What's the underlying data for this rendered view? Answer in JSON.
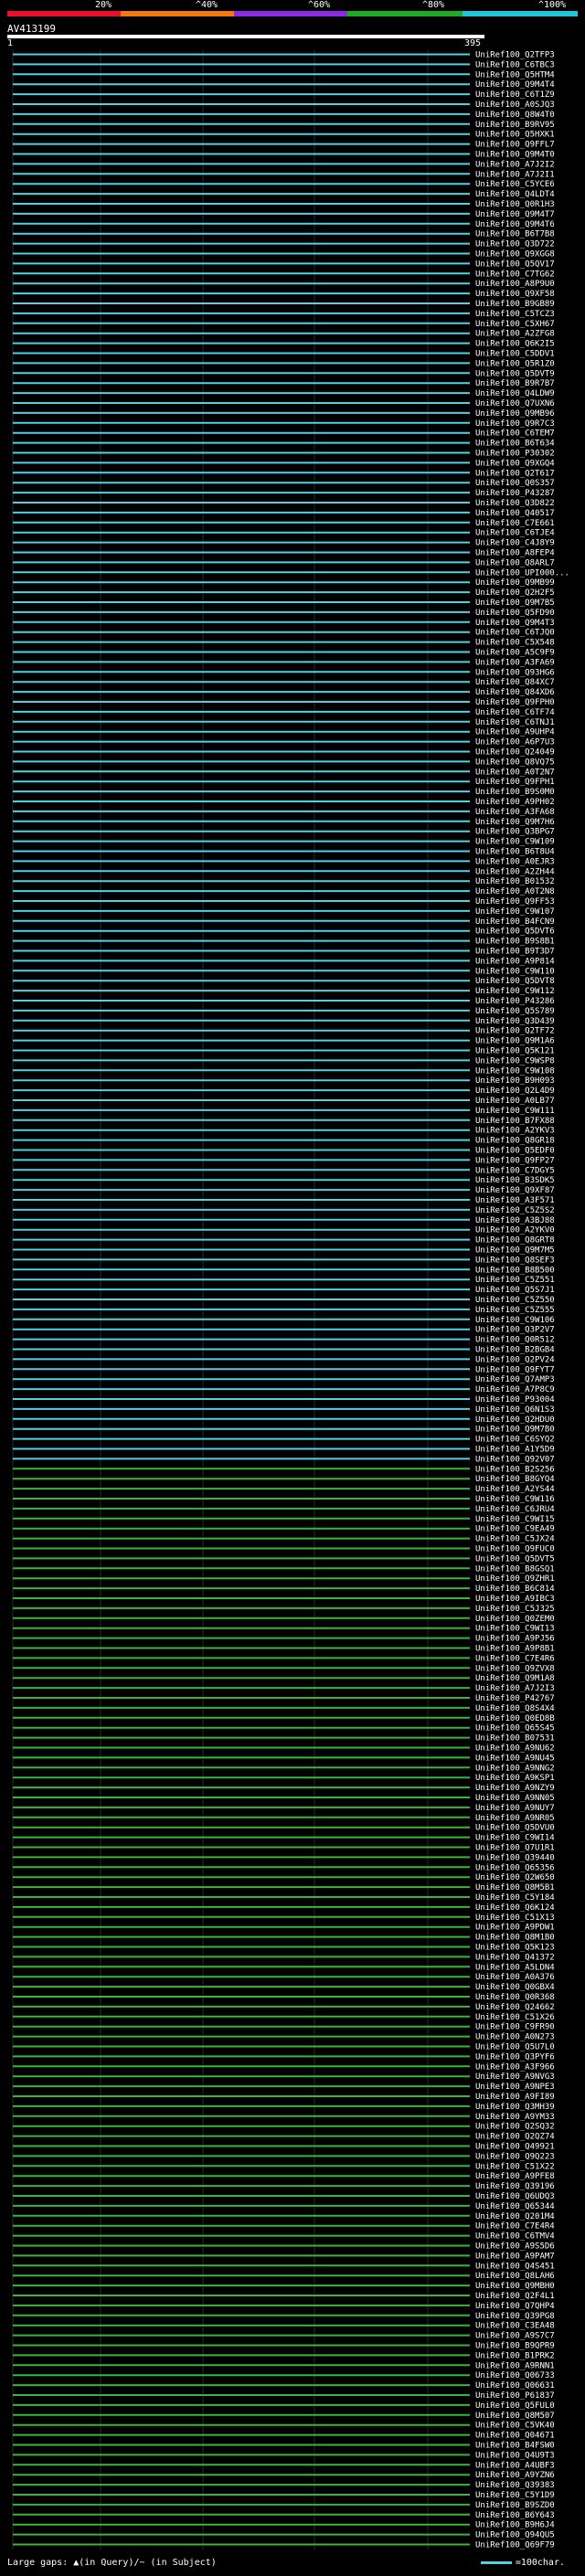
{
  "header": {
    "scale_labels": [
      "20%",
      "^40%",
      "^60%",
      "^80%",
      "^100%"
    ],
    "scale_colors": [
      "#e8102a",
      "#f07a10",
      "#8a2be2",
      "#22a822",
      "#22c4d8"
    ]
  },
  "query": {
    "title": "AV413199",
    "start": "1",
    "end": "395"
  },
  "footer": {
    "legend": "Large gaps: ▲(in Query)/~ (in Subject)",
    "scale_label": "=100char."
  },
  "colors": {
    "cyan": "#4fd1e8",
    "green": "#39b539",
    "grid": "#2a2a2a"
  },
  "hits": [
    "UniRef100_Q2TFP3",
    "UniRef100_C6TBC3",
    "UniRef100_Q5HTM4",
    "UniRef100_Q9M4T4",
    "UniRef100_C6T1Z9",
    "UniRef100_A0SJQ3",
    "UniRef100_Q8W4T0",
    "UniRef100_B9RV95",
    "UniRef100_Q5HXK1",
    "UniRef100_Q9FFL7",
    "UniRef100_Q9M4T0",
    "UniRef100_A7J2I2",
    "UniRef100_A7J2I1",
    "UniRef100_C5YCE6",
    "UniRef100_Q4LDT4",
    "UniRef100_Q0R1H3",
    "UniRef100_Q9M4T7",
    "UniRef100_Q9M4T6",
    "UniRef100_B6T7B8",
    "UniRef100_Q3D722",
    "UniRef100_Q9XGG8",
    "UniRef100_Q5QV17",
    "UniRef100_C7TG62",
    "UniRef100_A8P9U0",
    "UniRef100_Q9XF58",
    "UniRef100_B9GB89",
    "UniRef100_C5TCZ3",
    "UniRef100_C5XH67",
    "UniRef100_A2ZFG8",
    "UniRef100_Q6K2I5",
    "UniRef100_C5DDV1",
    "UniRef100_Q5R1Z0",
    "UniRef100_Q5DVT9",
    "UniRef100_B9R7B7",
    "UniRef100_Q4LDW9",
    "UniRef100_Q7UXN6",
    "UniRef100_Q9MB96",
    "UniRef100_Q9R7C3",
    "UniRef100_C6TEM7",
    "UniRef100_B6T634",
    "UniRef100_P30302",
    "UniRef100_Q9XGQ4",
    "UniRef100_Q2T617",
    "UniRef100_Q0S357",
    "UniRef100_P43287",
    "UniRef100_Q3D822",
    "UniRef100_Q40517",
    "UniRef100_C7E661",
    "UniRef100_C6TJE4",
    "UniRef100_C4J8Y9",
    "UniRef100_A8FEP4",
    "UniRef100_Q8ARL7",
    "UniRef100_UPI000...",
    "UniRef100_Q9MB99",
    "UniRef100_Q2H2F5",
    "UniRef100_Q9M7B5",
    "UniRef100_Q5FD90",
    "UniRef100_Q9M4T3",
    "UniRef100_C6TJQ0",
    "UniRef100_C5X548",
    "UniRef100_A5C9F9",
    "UniRef100_A3FA69",
    "UniRef100_Q93HG6",
    "UniRef100_Q84XC7",
    "UniRef100_Q84XD6",
    "UniRef100_Q9FPH0",
    "UniRef100_C6TF74",
    "UniRef100_C6TNJ1",
    "UniRef100_A9UHP4",
    "UniRef100_A6P7U3",
    "UniRef100_Q24049",
    "UniRef100_Q8VQ75",
    "UniRef100_A0T2N7",
    "UniRef100_Q9FPH1",
    "UniRef100_B9S0M0",
    "UniRef100_A9PH02",
    "UniRef100_A3FA68",
    "UniRef100_Q9M7H6",
    "UniRef100_Q3BPG7",
    "UniRef100_C9W109",
    "UniRef100_B6T8U4",
    "UniRef100_A0EJR3",
    "UniRef100_A2ZH44",
    "UniRef100_B01532",
    "UniRef100_A0T2N8",
    "UniRef100_Q9FF53",
    "UniRef100_C9W107",
    "UniRef100_B4FCN9",
    "UniRef100_Q5DVT6",
    "UniRef100_B9S8B1",
    "UniRef100_B9T3D7",
    "UniRef100_A9P814",
    "UniRef100_C9W110",
    "UniRef100_Q5DVT8",
    "UniRef100_C9W112",
    "UniRef100_P43286",
    "UniRef100_Q5S789",
    "UniRef100_Q3D439",
    "UniRef100_Q2TF72",
    "UniRef100_Q9M1A6",
    "UniRef100_Q5K121",
    "UniRef100_C9WSP8",
    "UniRef100_C9W108",
    "UniRef100_B9H093",
    "UniRef100_Q2L4D9",
    "UniRef100_A0LB77",
    "UniRef100_C9W111",
    "UniRef100_B7FX88",
    "UniRef100_A2YKV3",
    "UniRef100_Q8GR18",
    "UniRef100_Q5EDF0",
    "UniRef100_Q9FP27",
    "UniRef100_C7DGY5",
    "UniRef100_B3SDK5",
    "UniRef100_Q9XF87",
    "UniRef100_A3F571",
    "UniRef100_C5Z5S2",
    "UniRef100_A3BJ88",
    "UniRef100_A2YKV0",
    "UniRef100_Q8GRT8",
    "UniRef100_Q9M7M5",
    "UniRef100_Q8SEF3",
    "UniRef100_B8B500",
    "UniRef100_C5Z551",
    "UniRef100_Q5S7J1",
    "UniRef100_C5Z550",
    "UniRef100_C5Z555",
    "UniRef100_C9W106",
    "UniRef100_Q3P2V7",
    "UniRef100_Q0R512",
    "UniRef100_B2BGB4",
    "UniRef100_Q2PV24",
    "UniRef100_Q9FYT7",
    "UniRef100_Q7AMP3",
    "UniRef100_A7P8C9",
    "UniRef100_P93004",
    "UniRef100_Q6N1S3",
    "UniRef100_Q2HDU0",
    "UniRef100_Q9M7B0",
    "UniRef100_C6SYQ2",
    "UniRef100_A1Y5D9",
    "UniRef100_Q92V07",
    "UniRef100_B2S256",
    "UniRef100_B8GYQ4",
    "UniRef100_A2YS44",
    "UniRef100_C9W116",
    "UniRef100_C6JRU4",
    "UniRef100_C9WI15",
    "UniRef100_C9EA49",
    "UniRef100_C5JX24",
    "UniRef100_Q9FUC0",
    "UniRef100_Q5DVT5",
    "UniRef100_B8GSQ1",
    "UniRef100_Q9ZHR1",
    "UniRef100_B6C814",
    "UniRef100_A9IBC3",
    "UniRef100_C5J325",
    "UniRef100_Q0ZEM0",
    "UniRef100_C9WI13",
    "UniRef100_A9PJ56",
    "UniRef100_A9P8B1",
    "UniRef100_C7E4R6",
    "UniRef100_Q9ZVX8",
    "UniRef100_Q9M1A8",
    "UniRef100_A7J2I3",
    "UniRef100_P42767",
    "UniRef100_Q8S4X4",
    "UniRef100_Q0ED8B",
    "UniRef100_Q65S45",
    "UniRef100_B07531",
    "UniRef100_A9NU62",
    "UniRef100_A9NU45",
    "UniRef100_A9NNG2",
    "UniRef100_A9KSP1",
    "UniRef100_A9NZY9",
    "UniRef100_A9NN05",
    "UniRef100_A9NUY7",
    "UniRef100_A9NR05",
    "UniRef100_Q5DVU0",
    "UniRef100_C9WI14",
    "UniRef100_Q7U1R1",
    "UniRef100_Q39440",
    "UniRef100_Q65356",
    "UniRef100_Q2W650",
    "UniRef100_Q8M5B1",
    "UniRef100_C5Y184",
    "UniRef100_Q6K124",
    "UniRef100_C51X13",
    "UniRef100_A9PDW1",
    "UniRef100_Q8M1B0",
    "UniRef100_Q5K123",
    "UniRef100_Q41372",
    "UniRef100_A5LDN4",
    "UniRef100_A0A376",
    "UniRef100_Q0GBX4",
    "UniRef100_Q0R368",
    "UniRef100_Q24662",
    "UniRef100_C51X26",
    "UniRef100_C9FR90",
    "UniRef100_A0N273",
    "UniRef100_Q5U7L0",
    "UniRef100_Q3PYF6",
    "UniRef100_A3F966",
    "UniRef100_A9NVG3",
    "UniRef100_A9NPE3",
    "UniRef100_A9FI89",
    "UniRef100_Q3MH39",
    "UniRef100_A9YM33",
    "UniRef100_Q2SQ32",
    "UniRef100_Q2QZ74",
    "UniRef100_Q49921",
    "UniRef100_Q9Q223",
    "UniRef100_C51X22",
    "UniRef100_A9PFE8",
    "UniRef100_Q39196",
    "UniRef100_Q6UDQ3",
    "UniRef100_Q65344",
    "UniRef100_Q201M4",
    "UniRef100_C7E4R4",
    "UniRef100_C6TMV4",
    "UniRef100_A9S5D6",
    "UniRef100_A9PAM7",
    "UniRef100_Q4S451",
    "UniRef100_Q8LAH6",
    "UniRef100_Q9MBH0",
    "UniRef100_Q2F4L1",
    "UniRef100_Q7QHP4",
    "UniRef100_Q39PG8",
    "UniRef100_C3EA48",
    "UniRef100_A9S7C7",
    "UniRef100_B9QPR9",
    "UniRef100_B1PRK2",
    "UniRef100_A9RNN1",
    "UniRef100_Q06733",
    "UniRef100_Q06631",
    "UniRef100_P61837",
    "UniRef100_Q5FUL0",
    "UniRef100_Q8M507",
    "UniRef100_C5VK40",
    "UniRef100_Q04671",
    "UniRef100_B4FSW0",
    "UniRef100_Q4U9T3",
    "UniRef100_A4UBF3",
    "UniRef100_A9YZN6",
    "UniRef100_Q39383",
    "UniRef100_C5Y1D9",
    "UniRef100_B9SZD0",
    "UniRef100_B6Y643",
    "UniRef100_B9H6J4",
    "UniRef100_Q94QU5",
    "UniRef100_Q69F79"
  ]
}
